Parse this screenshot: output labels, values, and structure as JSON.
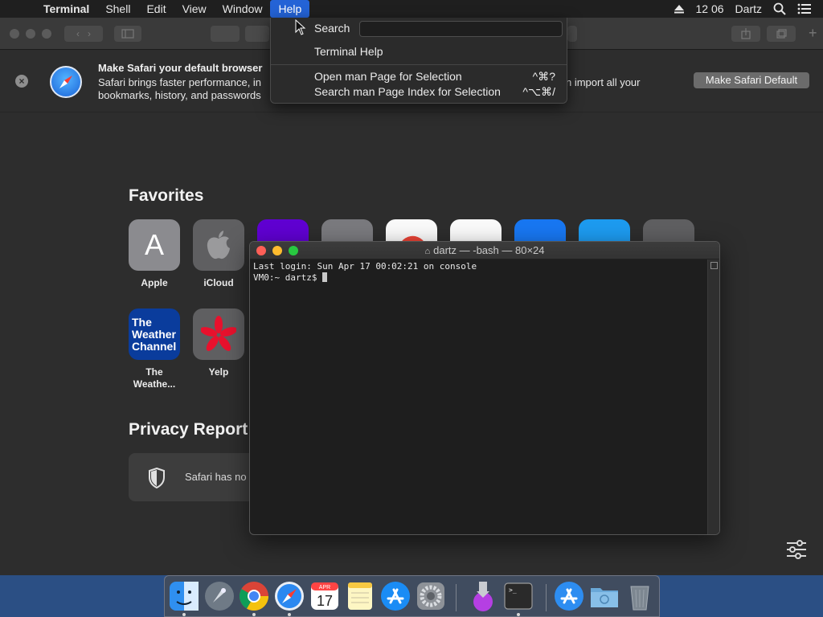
{
  "menubar": {
    "apple_glyph": "",
    "app_name": "Terminal",
    "menus": [
      "Shell",
      "Edit",
      "View",
      "Window",
      "Help"
    ],
    "active_menu": "Help",
    "clock": "12 06",
    "user": "Dartz",
    "icons": [
      "eject-icon",
      "spotlight-search-icon",
      "notification-center-icon"
    ]
  },
  "help_menu": {
    "search_label": "Search",
    "search_value": "",
    "items": [
      {
        "label": "Terminal Help",
        "shortcut": ""
      },
      {
        "label": "Open man Page for Selection",
        "shortcut": "^⌘?"
      },
      {
        "label": "Search man Page Index for Selection",
        "shortcut": "^⌥⌘/"
      }
    ]
  },
  "safari": {
    "banner": {
      "title": "Make Safari your default browser",
      "desc_line1": "Safari brings faster performance, in",
      "desc_line1_tail": "n import all your",
      "desc_line2": "bookmarks, history, and passwords",
      "button_label": "Make Safari Default"
    },
    "favorites_title": "Favorites",
    "favorites": [
      {
        "label": "Apple",
        "icon": "apple-letter-icon",
        "letter": "A",
        "bg": "#8b8b8f"
      },
      {
        "label": "iCloud",
        "icon": "apple-logo-icon",
        "bg": "#5f5f61"
      },
      {
        "label": "The Weathe...",
        "label_line1": "The",
        "label_line2": "Weathe...",
        "icon": "weather-channel-icon",
        "tile_text": [
          "The",
          "Weather",
          "Channel"
        ],
        "bg": "#0a3c9c"
      },
      {
        "label": "Yelp",
        "icon": "yelp-icon",
        "bg": "#5f5f61"
      }
    ],
    "privacy_title": "Privacy Report",
    "privacy_text": "Safari has no"
  },
  "terminal": {
    "title": "dartz — -bash — 80×24",
    "lines": [
      "Last login: Sun Apr 17 00:02:21 on console",
      "VM0:~ dartz$ "
    ]
  },
  "dock": {
    "items": [
      {
        "name": "finder",
        "running": true
      },
      {
        "name": "launchpad",
        "running": false
      },
      {
        "name": "chrome",
        "running": true
      },
      {
        "name": "safari",
        "running": true
      },
      {
        "name": "calendar",
        "running": false,
        "month": "APR",
        "day": "17"
      },
      {
        "name": "notes",
        "running": false
      },
      {
        "name": "app-store",
        "running": false
      },
      {
        "name": "system-preferences",
        "running": false
      },
      {
        "name": "installer",
        "running": false
      },
      {
        "name": "terminal",
        "running": true
      },
      {
        "name": "app-store-download",
        "running": false
      },
      {
        "name": "downloads-folder",
        "running": false
      },
      {
        "name": "trash",
        "running": false
      }
    ]
  },
  "colors": {
    "menu_highlight": "#2463d6",
    "desktop": "#2b4f84",
    "traffic_red": "#fe5f57",
    "traffic_yellow": "#febc2e",
    "traffic_green": "#28c840"
  }
}
